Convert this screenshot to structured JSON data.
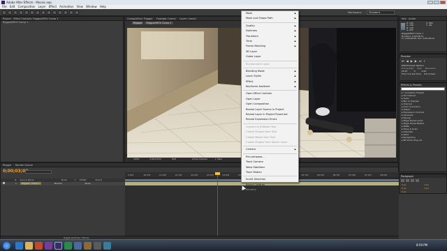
{
  "window": {
    "title": "Adobe After Effects - Mosaic.aep"
  },
  "menubar": [
    "File",
    "Edit",
    "Composition",
    "Layer",
    "Effect",
    "Animation",
    "View",
    "Window",
    "Help"
  ],
  "workspace": {
    "label": "Workspace:",
    "value": "Standard"
  },
  "search": {
    "placeholder": "Search Help"
  },
  "left_panel": {
    "tabs": [
      "Project",
      "Effect Controls: Riggpe/MOV Comp 1"
    ],
    "breadcrumb": "Riggpe/MOV Comp 1"
  },
  "comp_panel": {
    "tabs": [
      "Composition: Riggpe",
      "Footage: (none)",
      "Layer: (none)"
    ],
    "subtabs": [
      "Riggpe",
      "Riggpe/MOV Comp 1"
    ],
    "footer": [
      "100%",
      "0;00;03;02",
      "Half",
      "Active Camera",
      "1 View"
    ]
  },
  "info_panel": {
    "tabs": [
      "Info",
      "Audio"
    ],
    "rgb": [
      {
        "k": "R:",
        "v": "100"
      },
      {
        "k": "G:",
        "v": "126"
      },
      {
        "k": "B:",
        "v": "140"
      },
      {
        "k": "A:",
        "v": "255"
      }
    ],
    "xy": [
      {
        "k": "X:",
        "v": "662"
      },
      {
        "k": "Y:",
        "v": "-60"
      }
    ],
    "layer_name": "Riggpe/MOV Comp 1",
    "duration": "Duration: 0;00;28;11",
    "inout": "In: 0;00;00;00, Out: 0;00;28;10"
  },
  "preview_panel": {
    "title": "Preview",
    "ram_options": "RAM Preview Options",
    "frame_rate_label": "Frame Rate",
    "skip_label": "Skip",
    "resolution_label": "Resolution",
    "frame_rate": "29.97",
    "skip": "0",
    "resolution": "Auto",
    "from_current": "From Current Time",
    "full_screen": "Full Screen"
  },
  "effects_panel": {
    "title": "Effects & Presets",
    "items": [
      "* Animation Presets",
      "3D Channel",
      "Audio",
      "Blur & Sharpen",
      "Channel",
      "Color Correction",
      "Distort",
      "Expression Controls",
      "Generate",
      "Keying",
      "Magic Bullet Looks",
      "Magic Bullet MisFire",
      "Matte",
      "Noise & Grain",
      "Obsolete",
      "Paint",
      "Perspective",
      "RE:Vision Plug-ins"
    ]
  },
  "paragraph_panel": {
    "title": "Paragraph",
    "values": [
      "0 px",
      "0 px",
      "0 px",
      "0 px",
      "0 px"
    ]
  },
  "context_menu": {
    "items": [
      {
        "label": "Mask",
        "arrow": true,
        "disabled": false
      },
      {
        "label": "Mask and Shape Path",
        "arrow": true,
        "disabled": false
      },
      {
        "label": "Quality",
        "arrow": true,
        "disabled": false
      },
      {
        "label": "Switches",
        "arrow": true,
        "disabled": false
      },
      {
        "label": "Transform",
        "arrow": true,
        "disabled": false
      },
      {
        "label": "Time",
        "arrow": true,
        "disabled": false
      },
      {
        "label": "Frame Blending",
        "arrow": true,
        "disabled": false
      },
      {
        "label": "3D Layer",
        "arrow": false,
        "disabled": false
      },
      {
        "label": "Guide Layer",
        "arrow": false,
        "disabled": false
      },
      {
        "label": "Environment Layer",
        "arrow": false,
        "disabled": true
      },
      {
        "label": "Blending Mode",
        "arrow": true,
        "disabled": false
      },
      {
        "label": "Layer Styles",
        "arrow": true,
        "disabled": false
      },
      {
        "label": "Effect",
        "arrow": true,
        "disabled": false
      },
      {
        "label": "Keyframe Assistant",
        "arrow": true,
        "disabled": false
      },
      {
        "label": "Open Effect Controls",
        "arrow": false,
        "disabled": false
      },
      {
        "label": "Open Layer",
        "arrow": false,
        "disabled": false
      },
      {
        "label": "Open Composition",
        "arrow": false,
        "disabled": false
      },
      {
        "label": "Reveal Layer Source in Project",
        "arrow": false,
        "disabled": false
      },
      {
        "label": "Reveal Layer in Project Flowchart",
        "arrow": false,
        "disabled": false
      },
      {
        "label": "Reveal Expression Errors",
        "arrow": false,
        "disabled": false
      },
      {
        "label": "Convert to Editable Text",
        "arrow": false,
        "disabled": true
      },
      {
        "label": "Create Shapes from Text",
        "arrow": false,
        "disabled": true
      },
      {
        "label": "Create Masks from Text",
        "arrow": false,
        "disabled": true
      },
      {
        "label": "Create Shapes from Vector Layer",
        "arrow": false,
        "disabled": true
      },
      {
        "label": "Camera",
        "arrow": true,
        "disabled": false
      },
      {
        "label": "Pre-compose...",
        "arrow": false,
        "disabled": false
      },
      {
        "label": "Track Camera",
        "arrow": false,
        "disabled": false
      },
      {
        "label": "Warp Stabilizer",
        "arrow": false,
        "disabled": false
      },
      {
        "label": "Track Motion",
        "arrow": false,
        "disabled": false
      },
      {
        "label": "Invert Selection",
        "arrow": false,
        "disabled": false
      },
      {
        "label": "Select Children",
        "arrow": false,
        "disabled": false
      },
      {
        "label": "Rename",
        "arrow": false,
        "disabled": true
      }
    ],
    "separators_after": [
      1,
      8,
      9,
      13,
      19,
      23,
      24,
      28
    ]
  },
  "timeline": {
    "tabs": [
      "Riggpe",
      "Render Queue"
    ],
    "timecode": "0;00;03;02",
    "layer_header": [
      "#",
      "Source Name",
      "Mode",
      "T",
      "TrkMat",
      "Parent"
    ],
    "layer": {
      "num": "1",
      "name": "Riggpe/...Comp 1",
      "mode": "Normal",
      "parent": "None"
    },
    "ruler": [
      "0:00f",
      "00:15f",
      "01:00f",
      "01:15f",
      "02:00f",
      "02:15f",
      "03:00f",
      "03:15f",
      "04:00f",
      "04:15f",
      "05:00f",
      "05:15f",
      "06:00f",
      "06:15f",
      "07:00f",
      "07:15f",
      "08:00f"
    ],
    "footer": "Toggle Switches / Modes"
  },
  "taskbar": {
    "time": "8:59 PM"
  },
  "colors": {
    "accent": "#f0a030",
    "playhead": "#d02a2a",
    "layer_bar": "#b7b17b"
  }
}
